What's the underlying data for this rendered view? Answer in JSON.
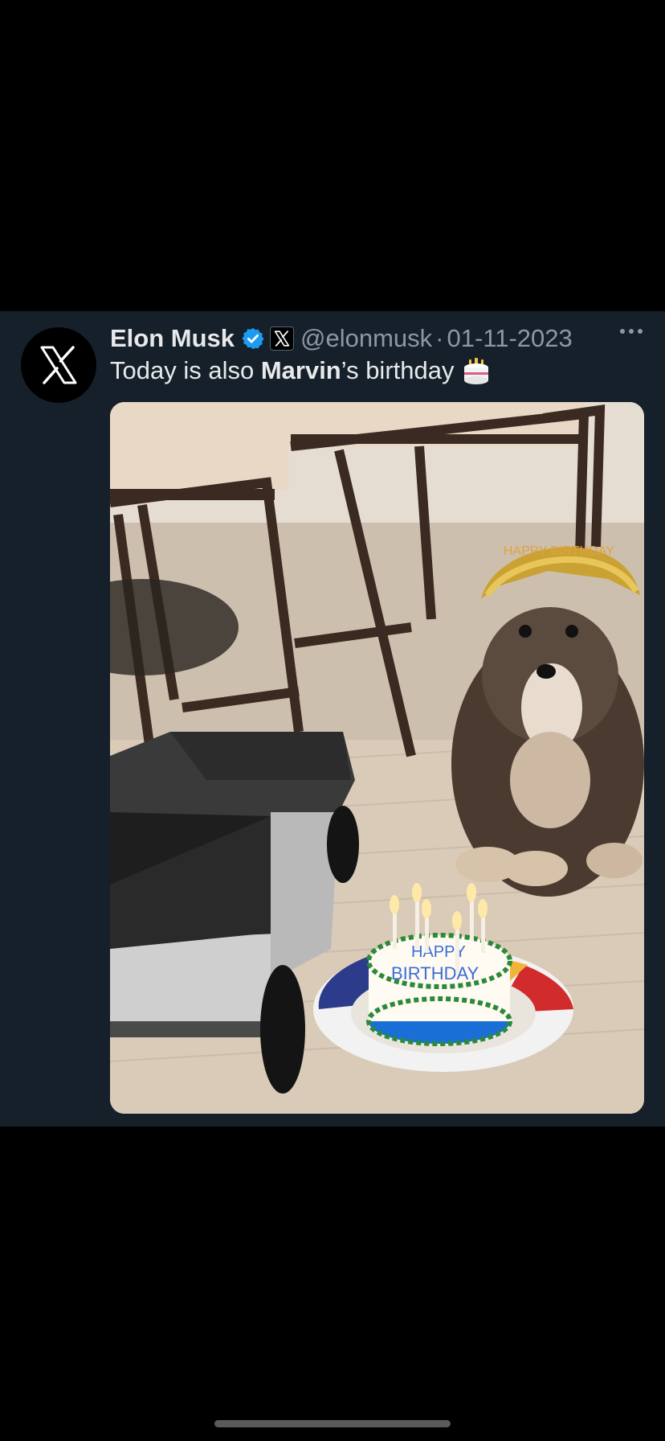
{
  "tweet": {
    "author_name": "Elon Musk",
    "handle": "@elonmusk",
    "separator": "·",
    "date": "01-11-2023",
    "text_before": "Today is also ",
    "text_bold": "Marvin",
    "text_after": "’s birthday",
    "avatar_icon": "x-logo-icon",
    "verified_icon": "verified-badge-icon",
    "affiliation_icon": "x-logo-icon",
    "more_icon": "more-dots-icon",
    "emoji_icon": "birthday-cake-emoji-icon",
    "media": {
      "description_icon": "photo-dog-birthday-cake-cybertruck",
      "cake_lines": [
        "HAPPY",
        "BIRTHDAY"
      ],
      "tiara_text": "HAPPY BIRTHDAY"
    }
  },
  "colors": {
    "background": "#000000",
    "tweet_bg": "#15202b",
    "primary_text": "#e7e9ea",
    "secondary_text": "#8b98a5",
    "verified_blue": "#1d9bf0"
  }
}
